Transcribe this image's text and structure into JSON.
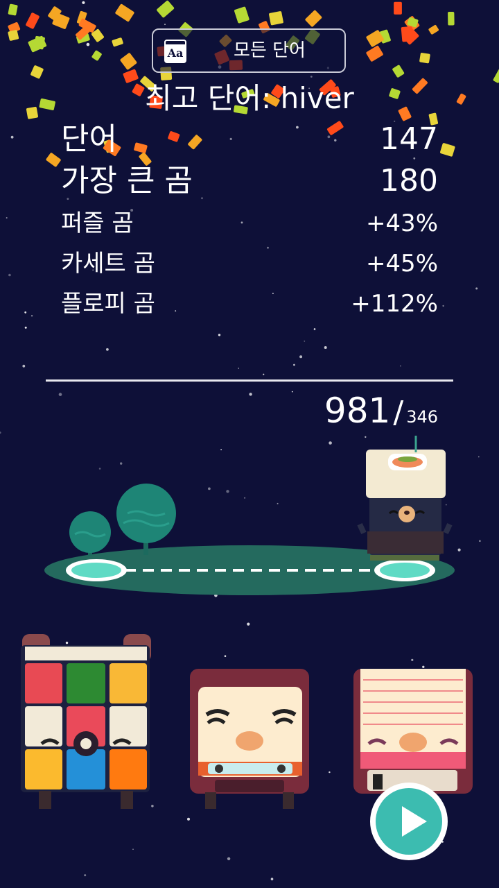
{
  "all_words_button": {
    "icon_text": "Aa",
    "label": "모든 단어"
  },
  "best_word": "최고 단어: hiver",
  "stats": [
    {
      "label": "단어",
      "value": "147"
    },
    {
      "label": "가장 큰 곰",
      "value": "180"
    },
    {
      "label": "퍼즐 곰",
      "value": "+43%"
    },
    {
      "label": "카세트 곰",
      "value": "+45%"
    },
    {
      "label": "플로피 곰",
      "value": "+112%"
    }
  ],
  "score": {
    "main": "981",
    "separator": "/",
    "sub": "346"
  },
  "icons": {
    "play": "play-icon",
    "dictionary": "dictionary-icon"
  },
  "colors": {
    "background": "#0e1038",
    "path_green": "#246a5e",
    "tree": "#1e8576",
    "node": "#5fdac4",
    "play": "#3cbcb0"
  }
}
